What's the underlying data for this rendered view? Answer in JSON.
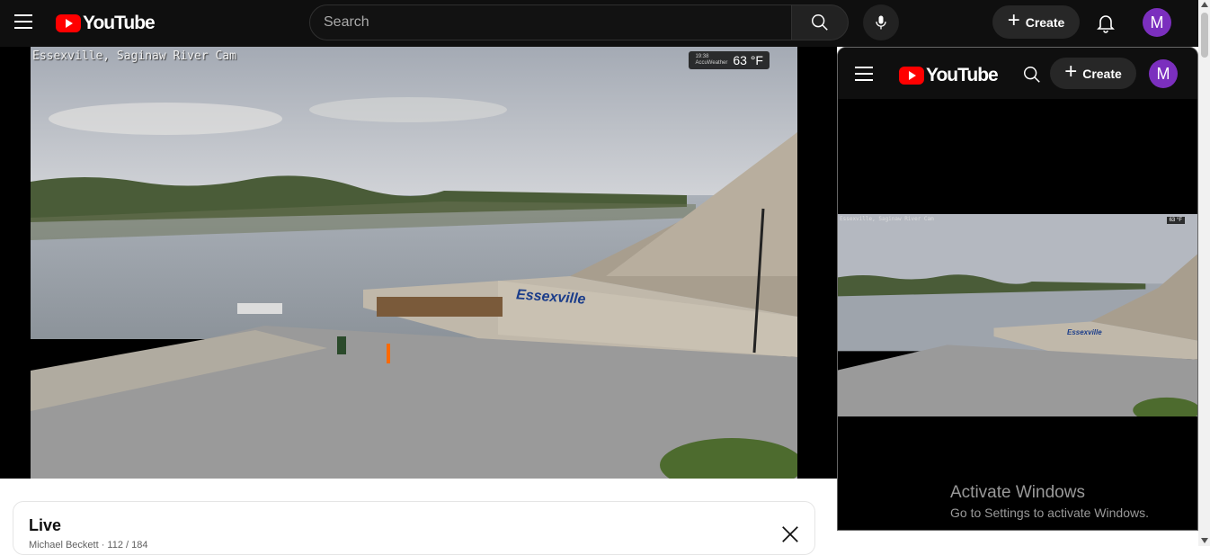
{
  "header": {
    "logo_text": "YouTube",
    "search_placeholder": "Search",
    "create_label": "Create",
    "avatar_letter": "M"
  },
  "player": {
    "cam_title": "Essexville, Saginaw River Cam",
    "weather_time": "19:38",
    "weather_brand": "AccuWeather",
    "weather_temp": "63 °F",
    "sign_text": "Essexville"
  },
  "info": {
    "title": "Live",
    "subtitle": "Michael Beckett · 112 / 184"
  },
  "mini_player": {
    "logo_text": "YouTube",
    "create_label": "Create",
    "avatar_letter": "M",
    "cam_title": "Essexville, Saginaw River Cam",
    "weather_temp": "63 °F",
    "sign_text": "Essexville"
  },
  "os_overlay": {
    "activate_title": "Activate Windows",
    "activate_sub": "Go to Settings to activate Windows."
  },
  "colors": {
    "topbar": "#0f0f0f",
    "brand_red": "#ff0000",
    "avatar": "#7b2fbe"
  }
}
